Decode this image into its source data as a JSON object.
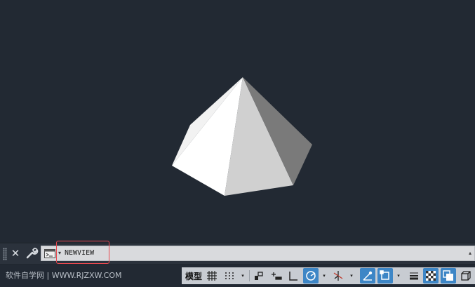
{
  "command_line": {
    "input_value": "NEWVIEW",
    "close_glyph": "✕",
    "prompt_arrow_glyph": "▾",
    "scroll_glyph": "▴"
  },
  "status_bar": {
    "watermark": "软件自学网 | WWW.RJZXW.COM",
    "model_tab_label": "模型",
    "caret_glyph": "▾"
  },
  "icons": [
    "grip-icon",
    "close-icon",
    "wrench-icon",
    "command-prompt-icon",
    "grid-icon",
    "snap-icon",
    "infer-constraints-icon",
    "dynamic-input-icon",
    "ortho-icon",
    "polar-icon",
    "isodraft-icon",
    "object-track-icon",
    "osnap-icon",
    "lineweight-icon",
    "transparency-icon",
    "selection-cycling-icon",
    "3d-osnap-icon"
  ],
  "colors": {
    "viewport_bg": "#222933",
    "highlight_border": "#e8484f",
    "active_toggle": "#3d86c6"
  }
}
